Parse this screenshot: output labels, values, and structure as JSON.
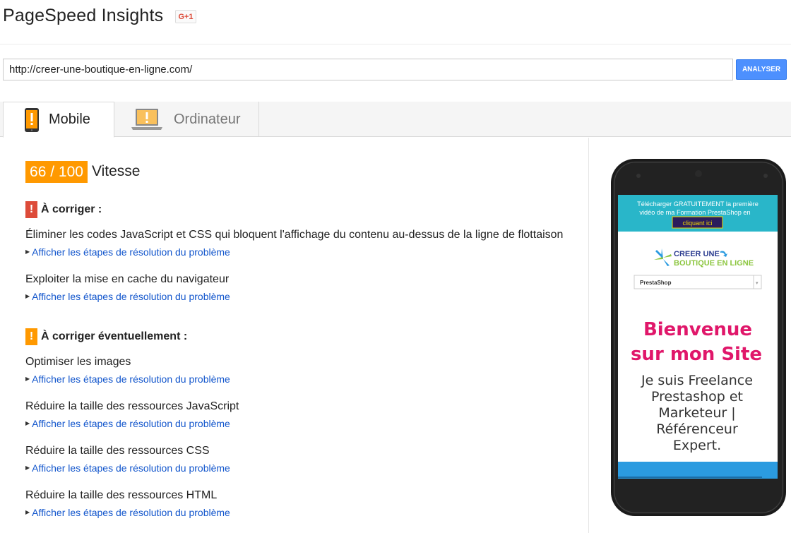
{
  "header": {
    "title": "PageSpeed Insights",
    "gplus_label": "G+1"
  },
  "search": {
    "url_value": "http://creer-une-boutique-en-ligne.com/",
    "analyze_label": "ANALYSER"
  },
  "tabs": [
    {
      "label": "Mobile",
      "icon": "mobile-warning-icon",
      "active": true
    },
    {
      "label": "Ordinateur",
      "icon": "desktop-warning-icon",
      "active": false
    }
  ],
  "score": {
    "value": "66 / 100",
    "label": "Vitesse",
    "color": "#ff9900"
  },
  "sections": {
    "must_fix": {
      "title": "À corriger :",
      "color": "#dd4b39",
      "rules": [
        {
          "title": "Éliminer les codes JavaScript et CSS qui bloquent l'affichage du contenu au-dessus de la ligne de flottaison",
          "link": "Afficher les étapes de résolution du problème"
        },
        {
          "title": "Exploiter la mise en cache du navigateur",
          "link": "Afficher les étapes de résolution du problème"
        }
      ]
    },
    "should_fix": {
      "title": "À corriger éventuellement :",
      "color": "#ff9900",
      "rules": [
        {
          "title": "Optimiser les images",
          "link": "Afficher les étapes de résolution du problème"
        },
        {
          "title": "Réduire la taille des ressources JavaScript",
          "link": "Afficher les étapes de résolution du problème"
        },
        {
          "title": "Réduire la taille des ressources CSS",
          "link": "Afficher les étapes de résolution du problème"
        },
        {
          "title": "Réduire la taille des ressources HTML",
          "link": "Afficher les étapes de résolution du problème"
        }
      ]
    }
  },
  "preview": {
    "banner_line1": "Télécharger GRATUITEMENT la première",
    "banner_line2": "vidéo de ma Formation PrestaShop en",
    "banner_button": "cliquant ici",
    "logo_line1": "CREER UNE",
    "logo_line2": "BOUTIQUE EN LIGNE",
    "select_value": "PrestaShop",
    "heading_line1": "Bienvenue",
    "heading_line2": "sur mon Site",
    "body_lines": [
      "Je suis Freelance",
      "Prestashop et",
      "Marketeur |",
      "Référenceur",
      "Expert."
    ],
    "colors": {
      "banner": "#29b6c9",
      "heading": "#e0176a",
      "footer_bar": "#2b9be0"
    }
  }
}
